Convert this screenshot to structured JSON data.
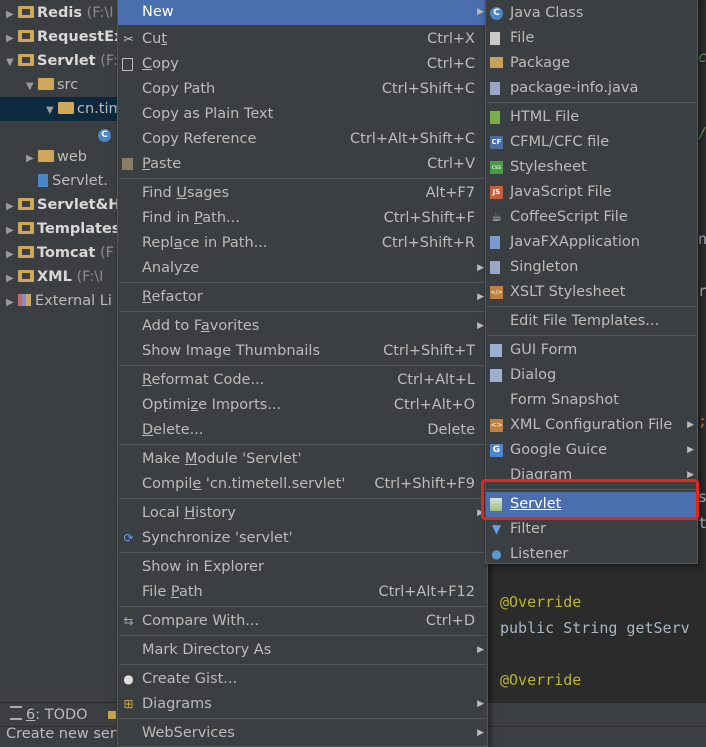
{
  "tree": [
    {
      "label": "Redis",
      "suffix": " (F:\\I",
      "bold": true,
      "indent": 0,
      "arrow": "▶",
      "icon": "folder-mod"
    },
    {
      "label": "RequestEx",
      "suffix": "",
      "bold": true,
      "indent": 0,
      "arrow": "▶",
      "icon": "folder-mod"
    },
    {
      "label": "Servlet",
      "suffix": " (F:",
      "bold": true,
      "indent": 0,
      "arrow": "▼",
      "icon": "folder-mod"
    },
    {
      "label": "src",
      "suffix": "",
      "bold": false,
      "indent": 1,
      "arrow": "▼",
      "icon": "folder"
    },
    {
      "label": "cn.tim",
      "suffix": "",
      "bold": false,
      "indent": 2,
      "arrow": "▼",
      "icon": "folder",
      "selected": true
    },
    {
      "label": "",
      "suffix": "",
      "bold": false,
      "indent": 4,
      "arrow": "",
      "icon": "class"
    },
    {
      "label": "web",
      "suffix": "",
      "bold": false,
      "indent": 1,
      "arrow": "▶",
      "icon": "folder"
    },
    {
      "label": "Servlet.",
      "suffix": "",
      "bold": false,
      "indent": 1,
      "arrow": "",
      "icon": "iml"
    },
    {
      "label": "Servlet&H",
      "suffix": "",
      "bold": true,
      "indent": 0,
      "arrow": "▶",
      "icon": "folder-mod"
    },
    {
      "label": "Templates",
      "suffix": "",
      "bold": true,
      "indent": 0,
      "arrow": "▶",
      "icon": "folder-mod"
    },
    {
      "label": "Tomcat",
      "suffix": " (F",
      "bold": true,
      "indent": 0,
      "arrow": "▶",
      "icon": "folder-mod"
    },
    {
      "label": "XML",
      "suffix": " (F:\\I",
      "bold": true,
      "indent": 0,
      "arrow": "▶",
      "icon": "folder-mod"
    },
    {
      "label": "External Li",
      "suffix": "",
      "bold": false,
      "indent": 0,
      "arrow": "▶",
      "icon": "lib"
    }
  ],
  "bottom": {
    "todo_num": "6",
    "todo_label": ": TODO",
    "status": "Create new serv"
  },
  "editor_lines": [
    {
      "text": "c",
      "color": "#629755",
      "italic": true
    },
    {
      "text": "/",
      "color": "#629755",
      "italic": true
    },
    {
      "text": "nc",
      "color": "#a9b7c6",
      "italic": false
    },
    {
      "text": "rv",
      "color": "#a9b7c6",
      "italic": false
    },
    {
      "text": ";",
      "color": "#cc7832",
      "italic": false
    },
    {
      "text": "s",
      "color": "#a9b7c6",
      "italic": false
    },
    {
      "text": "tl",
      "color": "#a9b7c6",
      "italic": false
    },
    {
      "text": "@Override",
      "color": "#bbb529",
      "italic": false
    },
    {
      "text": "public String getServ",
      "color": "#a9b7c6",
      "italic": false
    },
    {
      "text": "@Override",
      "color": "#bbb529",
      "italic": false
    }
  ],
  "context_menu": [
    {
      "label": "New",
      "shortcut": "",
      "sub": true,
      "highlight": true
    },
    {
      "label": "Cut",
      "shortcut": "Ctrl+X",
      "icon": "scissors-icon",
      "underline": "t",
      "pre": "Cu",
      "post": ""
    },
    {
      "label": "Copy",
      "shortcut": "Ctrl+C",
      "icon": "copy-icon",
      "pre": "",
      "underline": "C",
      "post": "opy"
    },
    {
      "label": "Copy Path",
      "shortcut": "Ctrl+Shift+C"
    },
    {
      "label": "Copy as Plain Text",
      "shortcut": ""
    },
    {
      "label": "Copy Reference",
      "shortcut": "Ctrl+Alt+Shift+C"
    },
    {
      "label": "Paste",
      "shortcut": "Ctrl+V",
      "icon": "paste-icon",
      "pre": "",
      "underline": "P",
      "post": "aste"
    },
    {
      "label": "Find Usages",
      "shortcut": "Alt+F7",
      "sep": true,
      "pre": "Find ",
      "underline": "U",
      "post": "sages"
    },
    {
      "label": "Find in Path...",
      "shortcut": "Ctrl+Shift+F",
      "pre": "Find in ",
      "underline": "P",
      "post": "ath..."
    },
    {
      "label": "Replace in Path...",
      "shortcut": "Ctrl+Shift+R",
      "pre": "Repl",
      "underline": "a",
      "post": "ce in Path..."
    },
    {
      "label": "Analyze",
      "shortcut": "",
      "sub": true
    },
    {
      "label": "Refactor",
      "shortcut": "",
      "sub": true,
      "sep": true,
      "pre": "",
      "underline": "R",
      "post": "efactor"
    },
    {
      "label": "Add to Favorites",
      "shortcut": "",
      "sub": true,
      "sep": true,
      "pre": "Add to F",
      "underline": "a",
      "post": "vorites"
    },
    {
      "label": "Show Image Thumbnails",
      "shortcut": "Ctrl+Shift+T"
    },
    {
      "label": "Reformat Code...",
      "shortcut": "Ctrl+Alt+L",
      "sep": true,
      "pre": "",
      "underline": "R",
      "post": "eformat Code..."
    },
    {
      "label": "Optimize Imports...",
      "shortcut": "Ctrl+Alt+O",
      "pre": "Optimi",
      "underline": "z",
      "post": "e Imports..."
    },
    {
      "label": "Delete...",
      "shortcut": "Delete",
      "pre": "",
      "underline": "D",
      "post": "elete..."
    },
    {
      "label": "Make Module 'Servlet'",
      "shortcut": "",
      "sep": true,
      "pre": "Make ",
      "underline": "M",
      "post": "odule 'Servlet'"
    },
    {
      "label": "Compile 'cn.timetell.servlet'",
      "shortcut": "Ctrl+Shift+F9",
      "pre": "Compil",
      "underline": "e",
      "post": " 'cn.timetell.servlet'"
    },
    {
      "label": "Local History",
      "shortcut": "",
      "sub": true,
      "sep": true,
      "pre": "Local ",
      "underline": "H",
      "post": "istory"
    },
    {
      "label": "Synchronize 'servlet'",
      "shortcut": "",
      "icon": "sync-icon"
    },
    {
      "label": "Show in Explorer",
      "shortcut": "",
      "sep": true
    },
    {
      "label": "File Path",
      "shortcut": "Ctrl+Alt+F12",
      "pre": "File ",
      "underline": "P",
      "post": "ath"
    },
    {
      "label": "Compare With...",
      "shortcut": "Ctrl+D",
      "icon": "compare-icon",
      "sep": true
    },
    {
      "label": "Mark Directory As",
      "shortcut": "",
      "sub": true,
      "sep": true
    },
    {
      "label": "Create Gist...",
      "shortcut": "",
      "icon": "github-icon",
      "sep": true
    },
    {
      "label": "Diagrams",
      "shortcut": "",
      "sub": true,
      "icon": "diagram-icon"
    },
    {
      "label": "WebServices",
      "shortcut": "",
      "sub": true,
      "sep": true
    }
  ],
  "submenu": [
    {
      "label": "Java Class",
      "icon": "java-class-icon"
    },
    {
      "label": "File",
      "icon": "file-icon"
    },
    {
      "label": "Package",
      "icon": "package-icon"
    },
    {
      "label": "package-info.java",
      "icon": "java-file-icon"
    },
    {
      "label": "HTML File",
      "icon": "html-icon",
      "sep": true
    },
    {
      "label": "CFML/CFC file",
      "icon": "cfml-icon"
    },
    {
      "label": "Stylesheet",
      "icon": "css-icon"
    },
    {
      "label": "JavaScript File",
      "icon": "js-icon"
    },
    {
      "label": "CoffeeScript File",
      "icon": "coffee-icon"
    },
    {
      "label": "JavaFXApplication",
      "icon": "javafx-icon"
    },
    {
      "label": "Singleton",
      "icon": "singleton-icon"
    },
    {
      "label": "XSLT Stylesheet",
      "icon": "xslt-icon"
    },
    {
      "label": "Edit File Templates...",
      "icon": "",
      "sep": true
    },
    {
      "label": "GUI Form",
      "icon": "gui-form-icon",
      "sep": true
    },
    {
      "label": "Dialog",
      "icon": "dialog-icon"
    },
    {
      "label": "Form Snapshot",
      "icon": ""
    },
    {
      "label": "XML Configuration File",
      "icon": "xml-icon",
      "sub": true
    },
    {
      "label": "Google Guice",
      "icon": "guice-icon",
      "sub": true
    },
    {
      "label": "Diagram",
      "icon": "",
      "sub": true
    },
    {
      "label": "Servlet",
      "icon": "servlet-icon",
      "highlight": true,
      "sep": true
    },
    {
      "label": "Filter",
      "icon": "filter-icon"
    },
    {
      "label": "Listener",
      "icon": "listener-icon"
    }
  ],
  "colors": {
    "highlight": "#4b6eaf",
    "callout": "#e0281e",
    "menu_bg": "#3c3f41",
    "editor_bg": "#2b2b2b"
  }
}
